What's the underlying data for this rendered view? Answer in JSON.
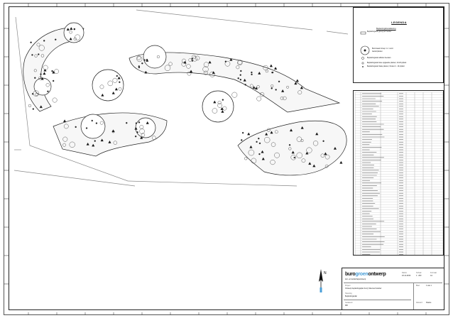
{
  "legend": {
    "title": "LEGENDA",
    "subtitle": "Beplantingsbestekening",
    "rows": [
      "Beplantingsvak groep per heester",
      "Boomnaam Groep: nr. / soort",
      "Aantal planten",
      "Beplantingsvak solitaire heesters",
      "Beplantingsvak losse opgaande planten; 10-20 p/plant",
      "Beplantingsvak Vaste planten; Cluster 2 - 10 p/plant"
    ]
  },
  "title_block": {
    "logo_part1": "buro",
    "logo_part2": "groen",
    "logo_part3": "ontwerp",
    "logo_sub": "tuin- en landschapsontwerp",
    "project_label": "Project",
    "project": "Ontwerp beplantingsplan Ferry Stientes Kwartier",
    "drawing_label": "Tekening",
    "drawing": "Beplantingsplan",
    "date_label": "Datum",
    "date": "23-11-2019",
    "scale_label": "Schaal",
    "scale": "1 : 200",
    "format_label": "Formaat",
    "format": "A1",
    "sheet_label": "Blad",
    "sheet": "1 van 1",
    "drawn_label": "Getekend",
    "drawn": "MR",
    "checked_label": "Akkoord",
    "checked": "Paulus"
  },
  "north_arrow_label": "N"
}
